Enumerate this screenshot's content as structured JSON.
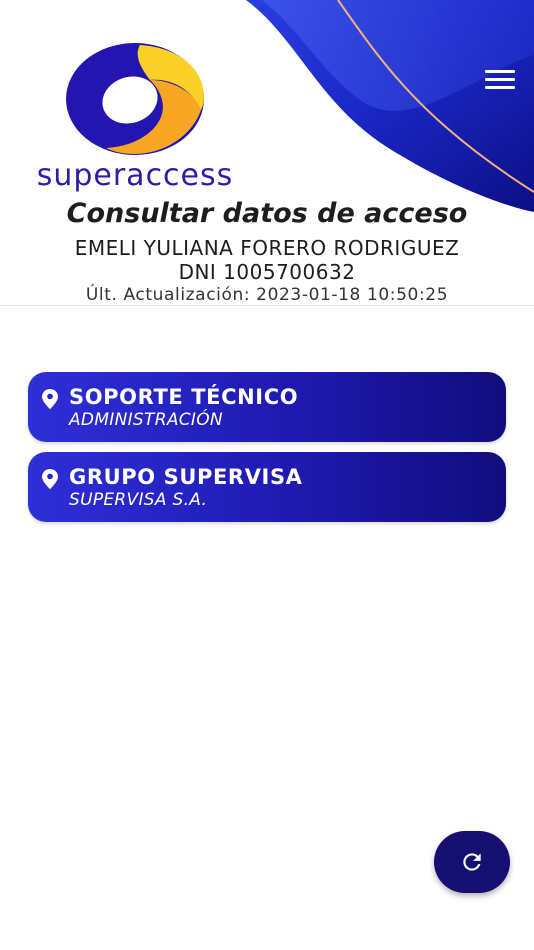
{
  "brand": {
    "logo_text": "superaccess",
    "colors": {
      "primary_blue": "#1e1ab0",
      "dark_blue": "#160f72",
      "accent_orange": "#f6a623",
      "accent_yellow": "#f9cf28"
    }
  },
  "header": {
    "menu_icon": "hamburger-menu-icon"
  },
  "page": {
    "title": "Consultar datos de acceso",
    "user_name": "EMELI YULIANA FORERO RODRIGUEZ",
    "user_dni": "DNI 1005700632",
    "last_update": "Últ. Actualización: 2023-01-18 10:50:25"
  },
  "access_list": [
    {
      "title": "SOPORTE TÉCNICO",
      "subtitle": "ADMINISTRACIÓN",
      "icon": "location-pin-icon"
    },
    {
      "title": "GRUPO SUPERVISA",
      "subtitle": "SUPERVISA S.A.",
      "icon": "location-pin-icon"
    }
  ],
  "fab": {
    "icon": "refresh-icon"
  }
}
